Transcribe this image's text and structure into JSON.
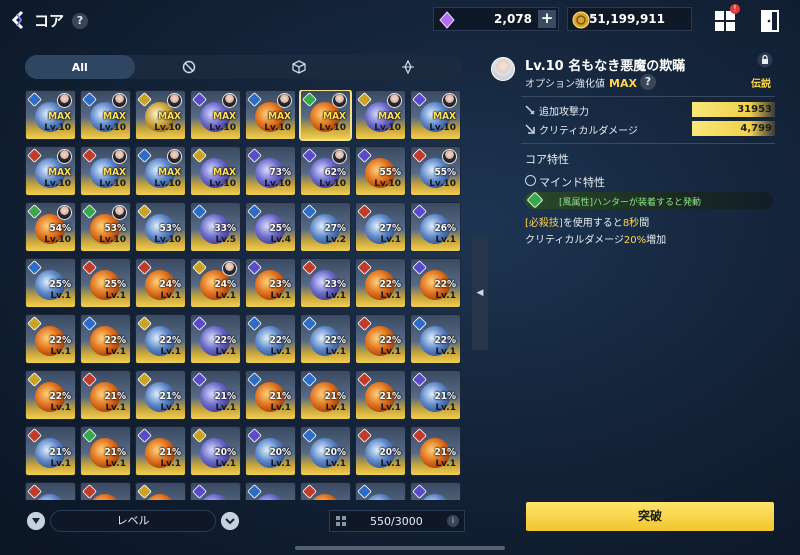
{
  "header": {
    "title": "コア",
    "help": "?",
    "gems": "2,078",
    "gold": "51,199,911",
    "plus": "+",
    "notification": "!"
  },
  "tabs": [
    {
      "label": "All",
      "icon": "all-text"
    },
    {
      "label": "",
      "icon": "circle-slash-icon"
    },
    {
      "label": "",
      "icon": "cube-icon"
    },
    {
      "label": "",
      "icon": "diamond-compass-icon"
    }
  ],
  "cores": [
    {
      "el": "water",
      "core": "water",
      "avatar": true,
      "pct": "MAX",
      "lv": "Lv.10"
    },
    {
      "el": "water",
      "core": "water",
      "avatar": true,
      "pct": "MAX",
      "lv": "Lv.10"
    },
    {
      "el": "light",
      "core": "light",
      "avatar": true,
      "pct": "MAX",
      "lv": "Lv.10"
    },
    {
      "el": "dark",
      "core": "dark",
      "avatar": true,
      "pct": "MAX",
      "lv": "Lv.10"
    },
    {
      "el": "water",
      "core": "fire",
      "avatar": true,
      "pct": "MAX",
      "lv": "Lv.10"
    },
    {
      "el": "wind",
      "core": "fire",
      "avatar": true,
      "pct": "MAX",
      "lv": "Lv.10",
      "selected": true
    },
    {
      "el": "light",
      "core": "dark",
      "avatar": true,
      "pct": "MAX",
      "lv": "Lv.10"
    },
    {
      "el": "dark",
      "core": "water",
      "avatar": true,
      "pct": "MAX",
      "lv": "Lv.10"
    },
    {
      "el": "fire",
      "core": "water",
      "avatar": true,
      "pct": "MAX",
      "lv": "Lv.10"
    },
    {
      "el": "fire",
      "core": "water",
      "avatar": true,
      "pct": "MAX",
      "lv": "Lv.10"
    },
    {
      "el": "water",
      "core": "water",
      "avatar": true,
      "pct": "MAX",
      "lv": "Lv.10"
    },
    {
      "el": "light",
      "core": "dark",
      "avatar": false,
      "pct": "MAX",
      "lv": "Lv.10"
    },
    {
      "el": "dark",
      "core": "dark",
      "avatar": false,
      "pct": "73%",
      "lv": "Lv.10"
    },
    {
      "el": "dark",
      "core": "dark",
      "avatar": true,
      "pct": "62%",
      "lv": "Lv.10"
    },
    {
      "el": "dark",
      "core": "fire",
      "avatar": false,
      "pct": "55%",
      "lv": "Lv.10"
    },
    {
      "el": "fire",
      "core": "water",
      "avatar": true,
      "pct": "55%",
      "lv": "Lv.10"
    },
    {
      "el": "wind",
      "core": "fire",
      "avatar": true,
      "pct": "54%",
      "lv": "Lv.10"
    },
    {
      "el": "wind",
      "core": "fire",
      "avatar": true,
      "pct": "53%",
      "lv": "Lv.10"
    },
    {
      "el": "light",
      "core": "water",
      "avatar": false,
      "pct": "53%",
      "lv": "Lv.10"
    },
    {
      "el": "water",
      "core": "dark",
      "avatar": false,
      "pct": "33%",
      "lv": "Lv.5"
    },
    {
      "el": "water",
      "core": "dark",
      "avatar": false,
      "pct": "25%",
      "lv": "Lv.4"
    },
    {
      "el": "water",
      "core": "water",
      "avatar": false,
      "pct": "27%",
      "lv": "Lv.2"
    },
    {
      "el": "fire",
      "core": "water",
      "avatar": false,
      "pct": "27%",
      "lv": "Lv.1"
    },
    {
      "el": "dark",
      "core": "water",
      "avatar": false,
      "pct": "26%",
      "lv": "Lv.1"
    },
    {
      "el": "water",
      "core": "water",
      "avatar": false,
      "pct": "25%",
      "lv": "Lv.1"
    },
    {
      "el": "fire",
      "core": "fire",
      "avatar": false,
      "pct": "25%",
      "lv": "Lv.1"
    },
    {
      "el": "fire",
      "core": "fire",
      "avatar": false,
      "pct": "24%",
      "lv": "Lv.1"
    },
    {
      "el": "light",
      "core": "fire",
      "avatar": true,
      "pct": "24%",
      "lv": "Lv.1"
    },
    {
      "el": "dark",
      "core": "fire",
      "avatar": false,
      "pct": "23%",
      "lv": "Lv.1"
    },
    {
      "el": "fire",
      "core": "dark",
      "avatar": false,
      "pct": "23%",
      "lv": "Lv.1"
    },
    {
      "el": "fire",
      "core": "fire",
      "avatar": false,
      "pct": "22%",
      "lv": "Lv.1"
    },
    {
      "el": "dark",
      "core": "fire",
      "avatar": false,
      "pct": "22%",
      "lv": "Lv.1"
    },
    {
      "el": "light",
      "core": "fire",
      "avatar": false,
      "pct": "22%",
      "lv": "Lv.1"
    },
    {
      "el": "water",
      "core": "fire",
      "avatar": false,
      "pct": "22%",
      "lv": "Lv.1"
    },
    {
      "el": "light",
      "core": "water",
      "avatar": false,
      "pct": "22%",
      "lv": "Lv.1"
    },
    {
      "el": "dark",
      "core": "dark",
      "avatar": false,
      "pct": "22%",
      "lv": "Lv.1"
    },
    {
      "el": "water",
      "core": "water",
      "avatar": false,
      "pct": "22%",
      "lv": "Lv.1"
    },
    {
      "el": "water",
      "core": "water",
      "avatar": false,
      "pct": "22%",
      "lv": "Lv.1"
    },
    {
      "el": "fire",
      "core": "fire",
      "avatar": false,
      "pct": "22%",
      "lv": "Lv.1"
    },
    {
      "el": "water",
      "core": "water",
      "avatar": false,
      "pct": "22%",
      "lv": "Lv.1"
    },
    {
      "el": "light",
      "core": "fire",
      "avatar": false,
      "pct": "22%",
      "lv": "Lv.1"
    },
    {
      "el": "fire",
      "core": "fire",
      "avatar": false,
      "pct": "21%",
      "lv": "Lv.1"
    },
    {
      "el": "light",
      "core": "water",
      "avatar": false,
      "pct": "21%",
      "lv": "Lv.1"
    },
    {
      "el": "dark",
      "core": "dark",
      "avatar": false,
      "pct": "21%",
      "lv": "Lv.1"
    },
    {
      "el": "water",
      "core": "fire",
      "avatar": false,
      "pct": "21%",
      "lv": "Lv.1"
    },
    {
      "el": "water",
      "core": "fire",
      "avatar": false,
      "pct": "21%",
      "lv": "Lv.1"
    },
    {
      "el": "fire",
      "core": "fire",
      "avatar": false,
      "pct": "21%",
      "lv": "Lv.1"
    },
    {
      "el": "dark",
      "core": "water",
      "avatar": false,
      "pct": "21%",
      "lv": "Lv.1"
    },
    {
      "el": "fire",
      "core": "water",
      "avatar": false,
      "pct": "21%",
      "lv": "Lv.1"
    },
    {
      "el": "wind",
      "core": "fire",
      "avatar": false,
      "pct": "21%",
      "lv": "Lv.1"
    },
    {
      "el": "dark",
      "core": "fire",
      "avatar": false,
      "pct": "21%",
      "lv": "Lv.1"
    },
    {
      "el": "light",
      "core": "dark",
      "avatar": false,
      "pct": "20%",
      "lv": "Lv.1"
    },
    {
      "el": "dark",
      "core": "water",
      "avatar": false,
      "pct": "20%",
      "lv": "Lv.1"
    },
    {
      "el": "water",
      "core": "water",
      "avatar": false,
      "pct": "20%",
      "lv": "Lv.1"
    },
    {
      "el": "fire",
      "core": "water",
      "avatar": false,
      "pct": "20%",
      "lv": "Lv.1"
    },
    {
      "el": "fire",
      "core": "fire",
      "avatar": false,
      "pct": "21%",
      "lv": "Lv.1"
    },
    {
      "el": "fire",
      "core": "water",
      "avatar": false,
      "pct": "",
      "lv": ""
    },
    {
      "el": "fire",
      "core": "fire",
      "avatar": false,
      "pct": "",
      "lv": ""
    },
    {
      "el": "light",
      "core": "fire",
      "avatar": false,
      "pct": "",
      "lv": ""
    },
    {
      "el": "dark",
      "core": "dark",
      "avatar": false,
      "pct": "",
      "lv": ""
    },
    {
      "el": "water",
      "core": "dark",
      "avatar": false,
      "pct": "",
      "lv": ""
    },
    {
      "el": "fire",
      "core": "fire",
      "avatar": false,
      "pct": "",
      "lv": ""
    },
    {
      "el": "water",
      "core": "water",
      "avatar": false,
      "pct": "",
      "lv": ""
    },
    {
      "el": "dark",
      "core": "water",
      "avatar": false,
      "pct": "",
      "lv": ""
    }
  ],
  "bottom": {
    "sort_label": "レベル",
    "capacity": "550/3000",
    "info": "i"
  },
  "detail": {
    "name": "Lv.10 名もなき悪魔の欺瞞",
    "option_label": "オプション強化値",
    "option_value": "MAX",
    "help": "?",
    "rarity": "伝説",
    "stats": [
      {
        "label": "追加攻撃力",
        "value": "31953"
      },
      {
        "label": "クリティカルダメージ",
        "value": "4,799"
      }
    ],
    "section_title": "コア特性",
    "trait_title": "マインド特性",
    "condition": "[風属性]ハンターが装着すると発動",
    "desc_line1_hl1": "[必殺技]",
    "desc_line1_mid": "を使用すると",
    "desc_line1_hl2": "8秒",
    "desc_line1_end": "間",
    "desc_line2_start": "クリティカルダメージ",
    "desc_line2_hl": "20%",
    "desc_line2_end": "増加",
    "button": "突破"
  },
  "colors": {
    "accent": "#f1c52e",
    "highlight": "#ffd54a",
    "bg": "#14243a"
  }
}
